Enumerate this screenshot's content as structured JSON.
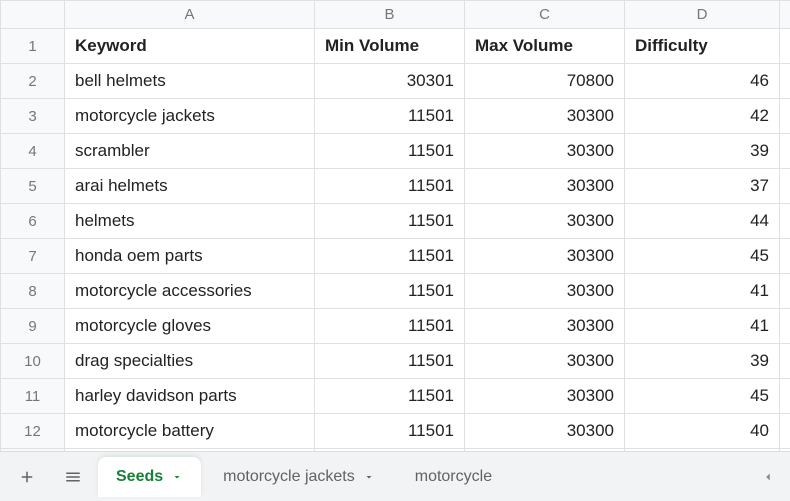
{
  "colors": {
    "accent": "#188038",
    "header_bg": "#f8f9fa",
    "grid_line": "#e0e0e0",
    "tabbar_bg": "#f1f3f4"
  },
  "columns": [
    "A",
    "B",
    "C",
    "D"
  ],
  "headers": {
    "a": "Keyword",
    "b": "Min Volume",
    "c": "Max Volume",
    "d": "Difficulty"
  },
  "rows": [
    {
      "n": "1"
    },
    {
      "n": "2",
      "a": "bell helmets",
      "b": "30301",
      "c": "70800",
      "d": "46"
    },
    {
      "n": "3",
      "a": "motorcycle jackets",
      "b": "11501",
      "c": "30300",
      "d": "42"
    },
    {
      "n": "4",
      "a": "scrambler",
      "b": "11501",
      "c": "30300",
      "d": "39"
    },
    {
      "n": "5",
      "a": "arai helmets",
      "b": "11501",
      "c": "30300",
      "d": "37"
    },
    {
      "n": "6",
      "a": "helmets",
      "b": "11501",
      "c": "30300",
      "d": "44"
    },
    {
      "n": "7",
      "a": "honda oem parts",
      "b": "11501",
      "c": "30300",
      "d": "45"
    },
    {
      "n": "8",
      "a": "motorcycle accessories",
      "b": "11501",
      "c": "30300",
      "d": "41"
    },
    {
      "n": "9",
      "a": "motorcycle gloves",
      "b": "11501",
      "c": "30300",
      "d": "41"
    },
    {
      "n": "10",
      "a": "drag specialties",
      "b": "11501",
      "c": "30300",
      "d": "39"
    },
    {
      "n": "11",
      "a": "harley davidson parts",
      "b": "11501",
      "c": "30300",
      "d": "45"
    },
    {
      "n": "12",
      "a": "motorcycle battery",
      "b": "11501",
      "c": "30300",
      "d": "40"
    }
  ],
  "tabs": {
    "active": "Seeds",
    "others": [
      "motorcycle jackets",
      "motorcycle"
    ]
  },
  "chart_data": {
    "type": "table",
    "columns": [
      "Keyword",
      "Min Volume",
      "Max Volume",
      "Difficulty"
    ],
    "rows": [
      [
        "bell helmets",
        30301,
        70800,
        46
      ],
      [
        "motorcycle jackets",
        11501,
        30300,
        42
      ],
      [
        "scrambler",
        11501,
        30300,
        39
      ],
      [
        "arai helmets",
        11501,
        30300,
        37
      ],
      [
        "helmets",
        11501,
        30300,
        44
      ],
      [
        "honda oem parts",
        11501,
        30300,
        45
      ],
      [
        "motorcycle accessories",
        11501,
        30300,
        41
      ],
      [
        "motorcycle gloves",
        11501,
        30300,
        41
      ],
      [
        "drag specialties",
        11501,
        30300,
        39
      ],
      [
        "harley davidson parts",
        11501,
        30300,
        45
      ],
      [
        "motorcycle battery",
        11501,
        30300,
        40
      ]
    ]
  }
}
